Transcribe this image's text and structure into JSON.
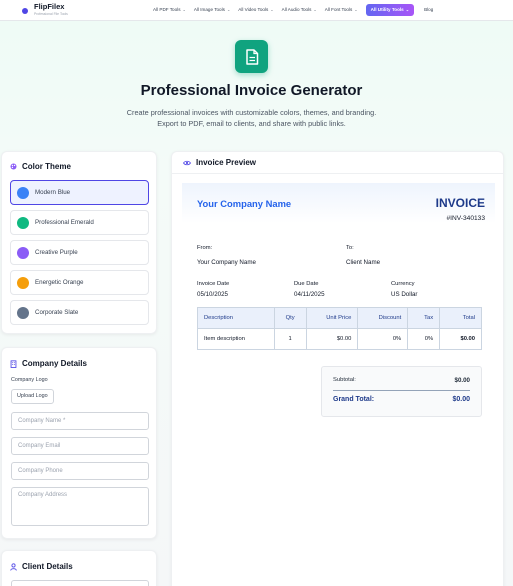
{
  "nav": {
    "brand_name": "FlipFilex",
    "brand_tagline": "Professional File Tools",
    "items": [
      {
        "label": "All PDF Tools"
      },
      {
        "label": "All Image Tools"
      },
      {
        "label": "All Video Tools"
      },
      {
        "label": "All Audio Tools"
      },
      {
        "label": "All Font Tools"
      },
      {
        "label": "All Utility Tools"
      },
      {
        "label": "Blog"
      }
    ]
  },
  "hero": {
    "title": "Professional Invoice Generator",
    "subtitle_line1": "Create professional invoices with customizable colors, themes, and branding.",
    "subtitle_line2": "Export to PDF, email to clients, and share with public links."
  },
  "color_theme": {
    "title": "Color Theme",
    "options": [
      {
        "label": "Modern Blue",
        "color": "#3b82f6",
        "selected": true
      },
      {
        "label": "Professional Emerald",
        "color": "#10b981",
        "selected": false
      },
      {
        "label": "Creative Purple",
        "color": "#8b5cf6",
        "selected": false
      },
      {
        "label": "Energetic Orange",
        "color": "#f59e0b",
        "selected": false
      },
      {
        "label": "Corporate Slate",
        "color": "#64748b",
        "selected": false
      }
    ]
  },
  "company_details": {
    "title": "Company Details",
    "logo_label": "Company Logo",
    "upload_label": "Upload Logo",
    "name_placeholder": "Company Name *",
    "email_placeholder": "Company Email",
    "phone_placeholder": "Company Phone",
    "address_placeholder": "Company Address"
  },
  "client_details": {
    "title": "Client Details"
  },
  "preview": {
    "title": "Invoice Preview",
    "company_name": "Your Company Name",
    "invoice_word": "INVOICE",
    "invoice_number": "#INV-340133",
    "from_label": "From:",
    "from_value": "Your Company Name",
    "to_label": "To:",
    "to_value": "Client Name",
    "invoice_date_label": "Invoice Date",
    "invoice_date": "05/10/2025",
    "due_date_label": "Due Date",
    "due_date": "04/11/2025",
    "currency_label": "Currency",
    "currency": "US Dollar",
    "table": {
      "headers": [
        "Description",
        "Qty",
        "Unit Price",
        "Discount",
        "Tax",
        "Total"
      ],
      "rows": [
        [
          "Item description",
          "1",
          "$0.00",
          "0%",
          "0%",
          "$0.00"
        ]
      ]
    },
    "subtotal_label": "Subtotal:",
    "subtotal": "$0.00",
    "grand_total_label": "Grand Total:",
    "grand_total": "$0.00"
  },
  "colors": {
    "accent": "#4f46e5",
    "brand_green": "#10a37f",
    "invoice_blue": "#2563eb",
    "invoice_navy": "#1e3a8a"
  }
}
